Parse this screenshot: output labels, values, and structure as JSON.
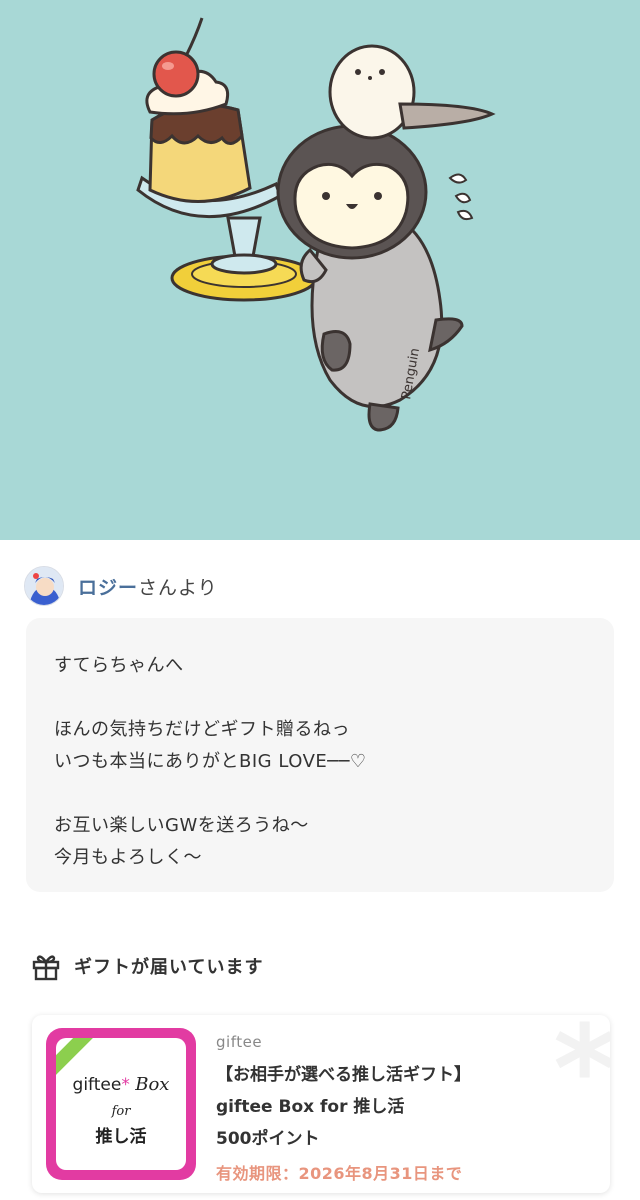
{
  "hero": {
    "signature": "Penguin"
  },
  "sender": {
    "name": "ロジー",
    "suffix": "さんより"
  },
  "message": {
    "lines": [
      "すてらちゃんへ",
      "",
      "ほんの気持ちだけどギフト贈るねっ",
      "いつも本当にありがとBIG LOVE──♡",
      "",
      "お互い楽しいGWを送ろうね〜",
      "今月もよろしく〜"
    ]
  },
  "gift_section": {
    "heading": "ギフトが届いています",
    "icon": "gift-icon"
  },
  "gift": {
    "brand": "giftee",
    "title": "【お相手が選べる推し活ギフト】",
    "name": "giftee Box for 推し活",
    "points": "500ポイント",
    "expiry": "有効期限：2026年8月31日まで",
    "thumbnail": {
      "brand_text": "giftee",
      "asterisk": "*",
      "box_text": "Box",
      "for_text": "for",
      "sub_text": "推し活"
    },
    "colors": {
      "thumb_border": "#e23ba2",
      "expiry": "#e8957e"
    }
  }
}
